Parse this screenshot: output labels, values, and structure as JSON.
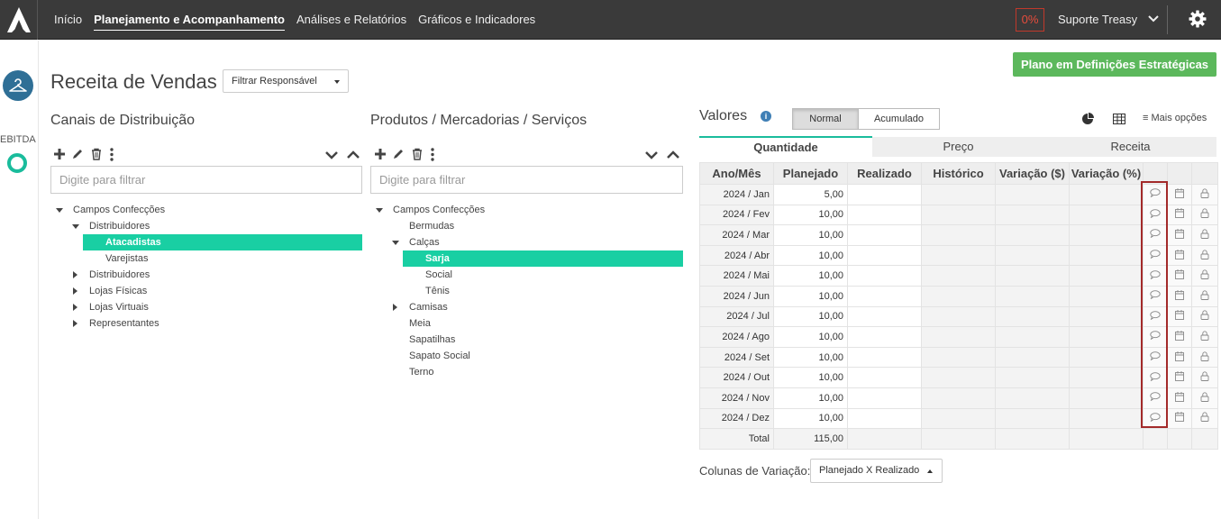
{
  "nav": {
    "items": [
      {
        "label": "Início",
        "active": false
      },
      {
        "label": "Planejamento e Acompanhamento",
        "active": true
      },
      {
        "label": "Análises e Relatórios",
        "active": false
      },
      {
        "label": "Gráficos e Indicadores",
        "active": false
      }
    ],
    "progress_badge": "0%",
    "user_name": "Suporte Treasy"
  },
  "rail": {
    "label": "EBITDA"
  },
  "header": {
    "title": "Receita de Vendas",
    "filter_label": "Filtrar Responsável",
    "plan_button": "Plano em Definições Estratégicas"
  },
  "channels": {
    "title": "Canais de Distribuição",
    "filter_placeholder": "Digite para filtrar",
    "tree": [
      {
        "label": "Campos Confecções",
        "level": 0,
        "expander": "open",
        "selected": false
      },
      {
        "label": "Distribuidores",
        "level": 1,
        "expander": "open",
        "selected": false
      },
      {
        "label": "Atacadistas",
        "level": 2,
        "expander": "none",
        "selected": true
      },
      {
        "label": "Varejistas",
        "level": 2,
        "expander": "none",
        "selected": false
      },
      {
        "label": "Distribuidores",
        "level": 1,
        "expander": "closed",
        "selected": false
      },
      {
        "label": "Lojas Físicas",
        "level": 1,
        "expander": "closed",
        "selected": false
      },
      {
        "label": "Lojas Virtuais",
        "level": 1,
        "expander": "closed",
        "selected": false
      },
      {
        "label": "Representantes",
        "level": 1,
        "expander": "closed",
        "selected": false
      }
    ]
  },
  "products": {
    "title": "Produtos / Mercadorias / Serviços",
    "filter_placeholder": "Digite para filtrar",
    "tree": [
      {
        "label": "Campos Confecções",
        "level": 0,
        "expander": "open",
        "selected": false
      },
      {
        "label": "Bermudas",
        "level": 1,
        "expander": "none",
        "selected": false
      },
      {
        "label": "Calças",
        "level": 1,
        "expander": "open",
        "selected": false
      },
      {
        "label": "Sarja",
        "level": 2,
        "expander": "none",
        "selected": true
      },
      {
        "label": "Social",
        "level": 2,
        "expander": "none",
        "selected": false
      },
      {
        "label": "Tênis",
        "level": 2,
        "expander": "none",
        "selected": false
      },
      {
        "label": "Camisas",
        "level": 1,
        "expander": "closed",
        "selected": false
      },
      {
        "label": "Meia",
        "level": 1,
        "expander": "none",
        "selected": false
      },
      {
        "label": "Sapatilhas",
        "level": 1,
        "expander": "none",
        "selected": false
      },
      {
        "label": "Sapato Social",
        "level": 1,
        "expander": "none",
        "selected": false
      },
      {
        "label": "Terno",
        "level": 1,
        "expander": "none",
        "selected": false
      }
    ]
  },
  "values": {
    "title": "Valores",
    "mode_normal": "Normal",
    "mode_accumulated": "Acumulado",
    "more_options": "Mais opções",
    "tabs": [
      {
        "label": "Quantidade",
        "active": true
      },
      {
        "label": "Preço",
        "active": false
      },
      {
        "label": "Receita",
        "active": false
      }
    ],
    "columns": [
      "Ano/Mês",
      "Planejado",
      "Realizado",
      "Histórico",
      "Variação ($)",
      "Variação (%)"
    ],
    "rows": [
      {
        "month": "2024 / Jan",
        "planned": "5,00"
      },
      {
        "month": "2024 / Fev",
        "planned": "10,00"
      },
      {
        "month": "2024 / Mar",
        "planned": "10,00"
      },
      {
        "month": "2024 / Abr",
        "planned": "10,00"
      },
      {
        "month": "2024 / Mai",
        "planned": "10,00"
      },
      {
        "month": "2024 / Jun",
        "planned": "10,00"
      },
      {
        "month": "2024 / Jul",
        "planned": "10,00"
      },
      {
        "month": "2024 / Ago",
        "planned": "10,00"
      },
      {
        "month": "2024 / Set",
        "planned": "10,00"
      },
      {
        "month": "2024 / Out",
        "planned": "10,00"
      },
      {
        "month": "2024 / Nov",
        "planned": "10,00"
      },
      {
        "month": "2024 / Dez",
        "planned": "10,00"
      }
    ],
    "total_label": "Total",
    "total_planned": "115,00",
    "variation_label": "Colunas de Variação:",
    "variation_select": "Planejado X Realizado"
  },
  "colors": {
    "topbar": "#3a3a3a",
    "selection": "#19cfa3",
    "primary_button": "#5cb85c",
    "highlight_border": "#a32a2a"
  }
}
